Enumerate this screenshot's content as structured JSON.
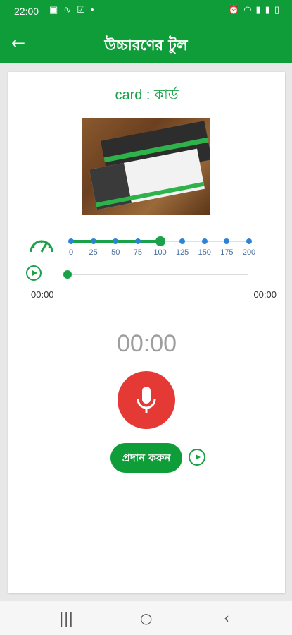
{
  "status_bar": {
    "time": "22:00",
    "left_icons": [
      "image-icon",
      "sign-icon",
      "check-icon",
      "dot-icon"
    ],
    "right_icons": [
      "alarm-icon",
      "wifi-icon",
      "signal-icon",
      "signal2-icon",
      "battery-icon"
    ]
  },
  "app_bar": {
    "back_icon": "arrow-left-icon",
    "title": "উচ্চারণের টুল"
  },
  "word": {
    "text": "card : কার্ড"
  },
  "speed": {
    "icon": "speedometer-icon",
    "ticks": [
      "0",
      "25",
      "50",
      "75",
      "100",
      "125",
      "150",
      "175",
      "200"
    ],
    "selected": "100"
  },
  "player": {
    "play_icon": "play-icon",
    "progress": 0,
    "current_time": "00:00",
    "total_time": "00:00"
  },
  "recorder": {
    "time": "00:00",
    "mic_icon": "microphone-icon"
  },
  "actions": {
    "submit_label": "প্রদান করুন",
    "play_icon": "play-icon"
  },
  "nav_bar": {
    "recents_icon": "recents-icon",
    "home_icon": "home-icon",
    "back_icon": "back-chevron-icon"
  },
  "colors": {
    "primary": "#0f9d3a",
    "accent_text": "#1aa14a",
    "record": "#e53935",
    "speed_dot": "#2d84d6"
  }
}
